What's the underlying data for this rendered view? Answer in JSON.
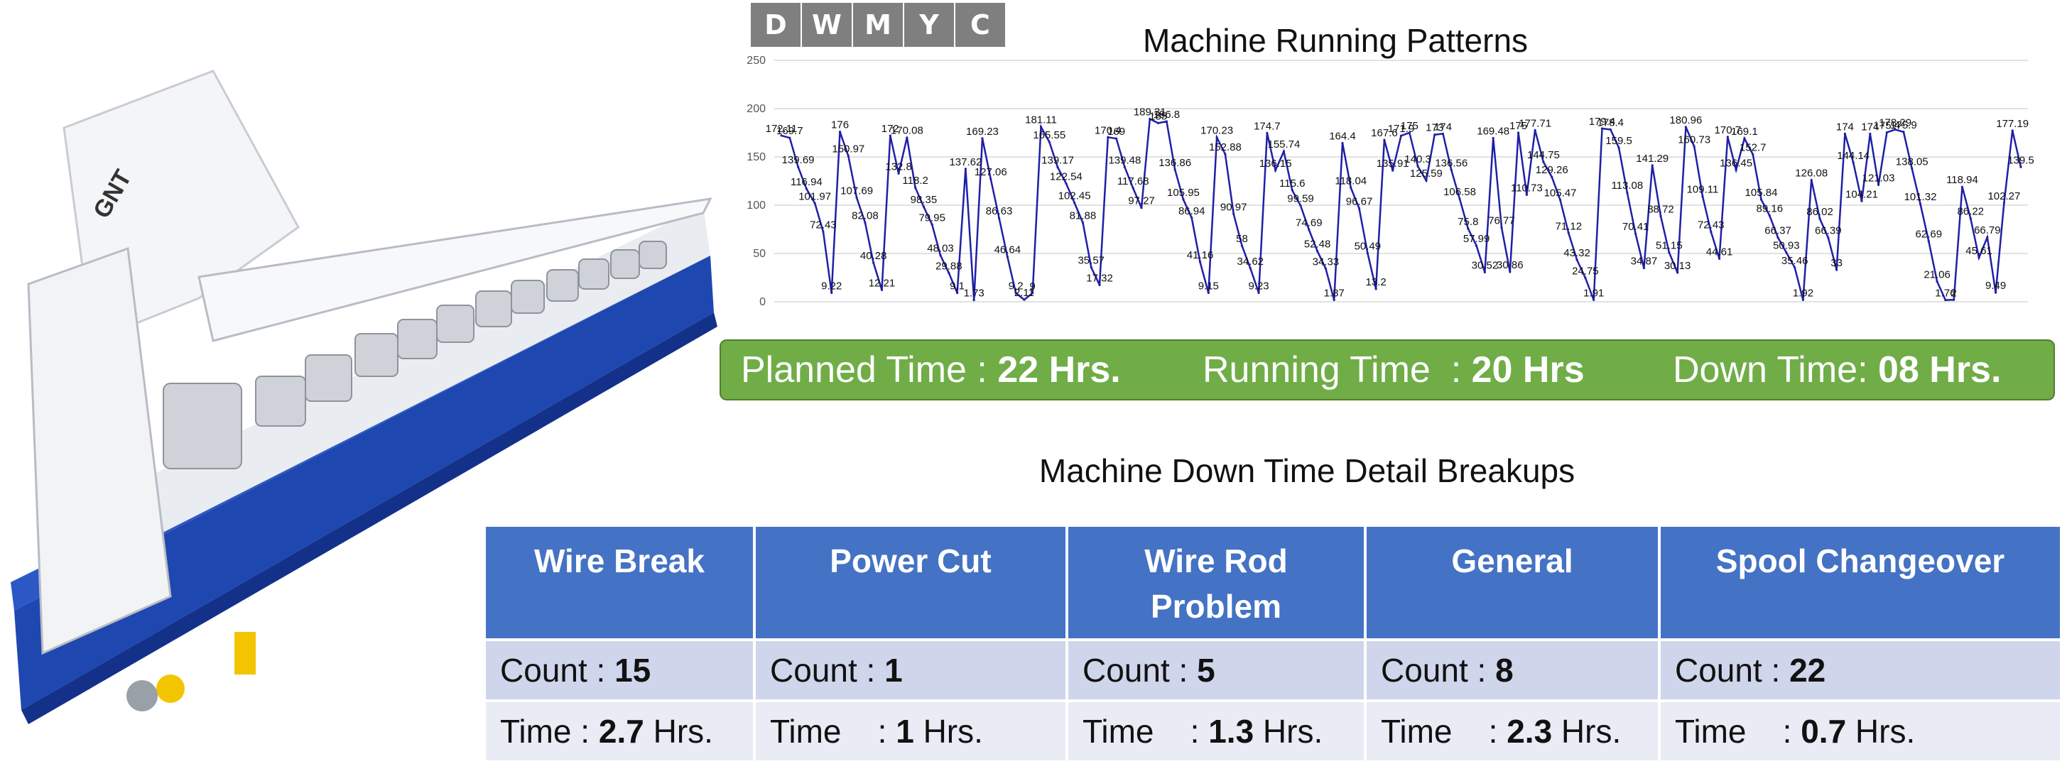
{
  "period_tabs": [
    {
      "label": "D"
    },
    {
      "label": "W"
    },
    {
      "label": "M"
    },
    {
      "label": "Y"
    },
    {
      "label": "C"
    }
  ],
  "chart_data": {
    "type": "line",
    "title": "Machine Running Patterns",
    "xlabel": "",
    "ylabel": "",
    "ylim": [
      0,
      250
    ],
    "yticks": [
      0,
      50,
      100,
      150,
      200,
      250
    ],
    "grid": true,
    "legend": "none",
    "colors": {
      "line": "#1f1fa8",
      "grid": "#d9d9d9"
    },
    "series": [
      {
        "values": [
          172.11,
          169.7,
          139.69,
          116.94,
          101.97,
          72.43,
          9.22,
          176,
          150.97,
          107.69,
          82.08,
          40.28,
          12.21,
          172,
          132.8,
          170.08,
          118.2,
          98.35,
          79.95,
          48.03,
          29.88,
          9.1,
          137.62,
          1.73,
          169.23,
          127.06,
          86.63,
          46.64,
          9.2,
          2.11,
          9.0,
          181.11,
          165.55,
          139.17,
          122.54,
          102.45,
          81.88,
          35.57,
          17.32,
          170.4,
          169,
          139.48,
          117.68,
          97.27,
          189.31,
          185,
          186.8,
          136.86,
          105.95,
          86.94,
          41.16,
          9.15,
          170.23,
          152.88,
          90.97,
          58,
          34.62,
          9.23,
          174.7,
          136.15,
          155.74,
          115.6,
          99.59,
          74.69,
          52.48,
          34.33,
          1.87,
          164.4,
          118.04,
          96.67,
          50.49,
          13.2,
          167.6,
          135.91,
          171.9,
          175,
          140.3,
          125.59,
          173,
          174,
          136.56,
          106.58,
          75.8,
          57.99,
          30.52,
          169.48,
          76.77,
          30.86,
          175,
          110.73,
          177.71,
          144.75,
          129.26,
          105.47,
          71.12,
          43.32,
          24.75,
          1.91,
          179.4,
          178.4,
          159.5,
          113.08,
          70.41,
          34.87,
          141.29,
          88.72,
          51.15,
          30.13,
          180.96,
          160.73,
          109.11,
          72.43,
          44.61,
          170.7,
          136.45,
          169.1,
          152.7,
          105.84,
          89.16,
          66.37,
          50.93,
          35.46,
          1.92,
          126.08,
          86.02,
          66.39,
          33,
          174,
          144.14,
          104.21,
          174,
          121.03,
          175.4,
          178.29,
          175.9,
          138.05,
          101.32,
          62.69,
          21.06,
          1.76,
          2,
          118.94,
          86.22,
          45.61,
          66.79,
          9.49,
          102.27,
          177.19,
          139.5
        ],
        "labels_shown": true
      }
    ]
  },
  "summary": {
    "planned_label": "Planned Time : ",
    "planned_value": "22 Hrs.",
    "running_label": "Running Time  : ",
    "running_value": "20 Hrs",
    "down_label": "Down Time: ",
    "down_value": "08 Hrs."
  },
  "breakup": {
    "title": "Machine Down Time Detail Breakups",
    "count_prefix": "Count : ",
    "columns": [
      {
        "name": "Wire Break",
        "count": "15",
        "time_prefix": "Time : ",
        "time_value": "2.7",
        "time_unit": " Hrs."
      },
      {
        "name": "Power Cut",
        "count": "1",
        "time_prefix": "Time    : ",
        "time_value": "1",
        "time_unit": " Hrs."
      },
      {
        "name": "Wire Rod Problem",
        "count": "5",
        "time_prefix": "Time    : ",
        "time_value": "1.3",
        "time_unit": " Hrs."
      },
      {
        "name": "General",
        "count": "8",
        "time_prefix": "Time    : ",
        "time_value": "2.3",
        "time_unit": " Hrs."
      },
      {
        "name": "Spool Changeover",
        "count": "22",
        "time_prefix": "Time    : ",
        "time_value": "0.7",
        "time_unit": " Hrs."
      }
    ]
  },
  "machine": {
    "logo_text": "GNT"
  }
}
